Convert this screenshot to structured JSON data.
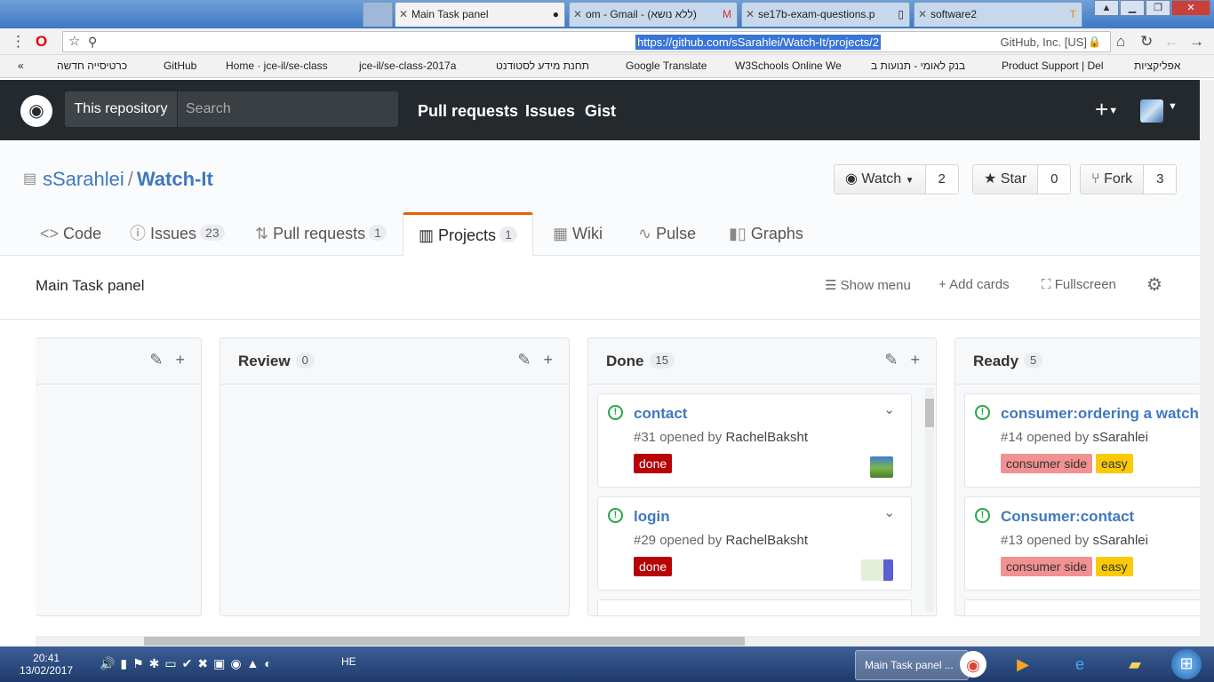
{
  "browser": {
    "tabs": [
      {
        "label": "Main Task panel",
        "icon": "github-icon",
        "active": true
      },
      {
        "label": "om - Gmail - (ללא נושא)",
        "icon": "gmail-icon"
      },
      {
        "label": "se17b-exam-questions.p",
        "icon": "document-icon"
      },
      {
        "label": "software2",
        "icon": "document-icon"
      }
    ],
    "url": "https://github.com/sSarahlei/Watch-It/projects/2",
    "cert": "GitHub, Inc. [US]",
    "bookmarks": [
      "כרטיסייה חדשה",
      "GitHub",
      "Home · jce-il/se-class",
      "jce-il/se-class-2017a",
      "תחנת מידע לסטודנט",
      "Google Translate",
      "W3Schools Online We",
      "בנק לאומי - תנועות ב",
      "Product Support | Del",
      "אפליקציות"
    ]
  },
  "github": {
    "scope": "This repository",
    "search_placeholder": "Search",
    "nav": [
      "Pull requests",
      "Issues",
      "Gist"
    ]
  },
  "repo": {
    "owner": "sSarahlei",
    "name": "Watch-It",
    "watch_label": "Watch",
    "watch_count": "2",
    "star_label": "Star",
    "star_count": "0",
    "fork_label": "Fork",
    "fork_count": "3",
    "tabs": [
      {
        "label": "Code",
        "count": ""
      },
      {
        "label": "Issues",
        "count": "23"
      },
      {
        "label": "Pull requests",
        "count": "1"
      },
      {
        "label": "Projects",
        "count": "1"
      },
      {
        "label": "Wiki",
        "count": ""
      },
      {
        "label": "Pulse",
        "count": ""
      },
      {
        "label": "Graphs",
        "count": ""
      }
    ]
  },
  "project": {
    "title": "Main Task panel",
    "show_menu": "Show menu",
    "add_cards": "Add cards",
    "fullscreen": "Fullscreen",
    "columns": [
      {
        "name": "Review",
        "count": "0"
      },
      {
        "name": "Done",
        "count": "15"
      },
      {
        "name": "Ready",
        "count": "5"
      }
    ],
    "done_cards": [
      {
        "title": "contact",
        "meta_prefix": "#31 opened by",
        "author": "RachelBaksht",
        "labels": [
          "done"
        ]
      },
      {
        "title": "login",
        "meta_prefix": "#29 opened by",
        "author": "RachelBaksht",
        "labels": [
          "done"
        ]
      }
    ],
    "ready_cards": [
      {
        "title": "consumer:ordering a watch",
        "meta_prefix": "#14 opened by",
        "author": "sSarahlei",
        "labels": [
          "consumer side",
          "easy"
        ]
      },
      {
        "title": "Consumer:contact",
        "meta_prefix": "#13 opened by",
        "author": "sSarahlei",
        "labels": [
          "consumer side",
          "easy"
        ]
      }
    ],
    "label_colors": {
      "done": "#b60205",
      "consumer side": "#f29191",
      "easy": "#fbca04"
    }
  },
  "taskbar": {
    "time": "20:41",
    "date": "13/02/2017",
    "lang": "HE",
    "task_label": "Main Task panel ..."
  }
}
